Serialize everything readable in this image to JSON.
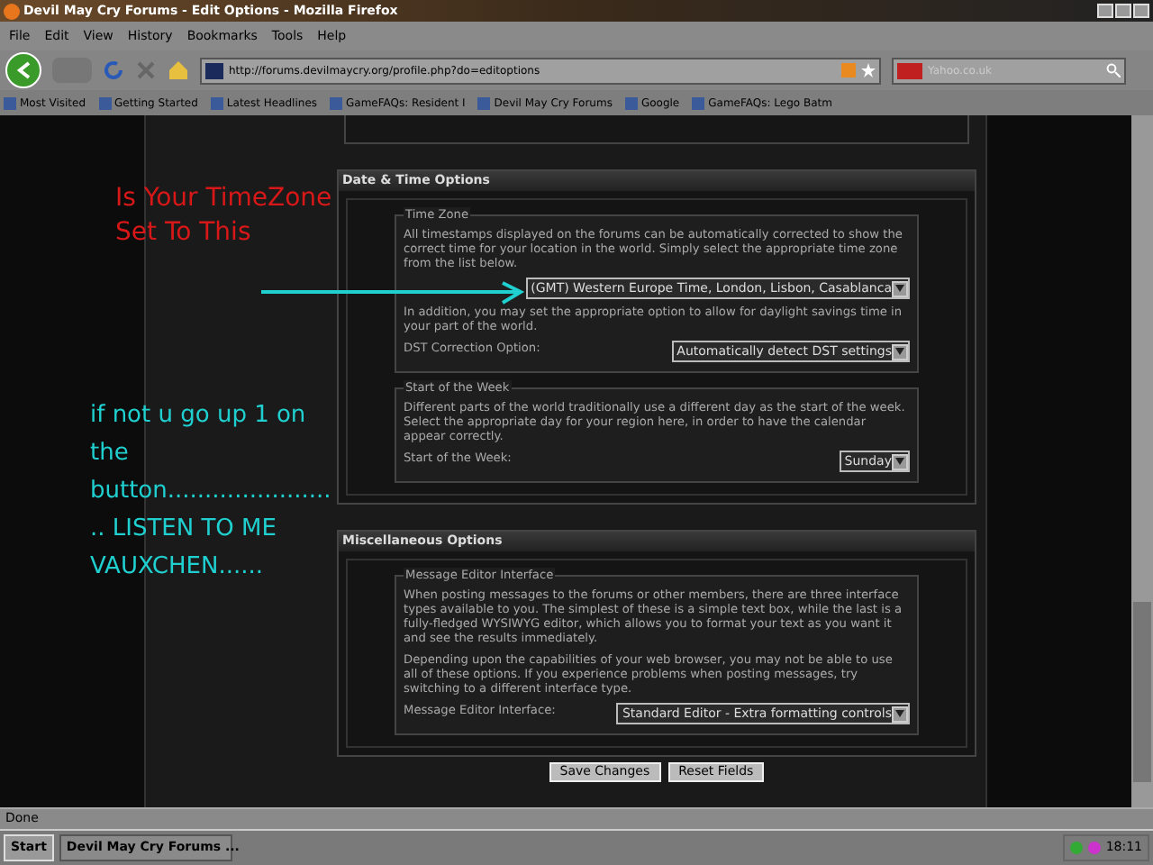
{
  "window": {
    "title": "Devil May Cry Forums - Edit Options - Mozilla Firefox"
  },
  "menu": [
    "File",
    "Edit",
    "View",
    "History",
    "Bookmarks",
    "Tools",
    "Help"
  ],
  "address_bar": {
    "value": "http://forums.devilmaycry.org/profile.php?do=editoptions"
  },
  "search": {
    "placeholder": "Yahoo.co.uk"
  },
  "bookmarks": [
    "Most Visited",
    "Getting Started",
    "Latest Headlines",
    "GameFAQs: Resident I",
    "Devil May Cry Forums",
    "Google",
    "GameFAQs: Lego Batm"
  ],
  "sections": [
    {
      "title": "Date & Time Options",
      "fieldsets": [
        {
          "legend": "Time Zone",
          "rows": [
            {
              "kind": "text",
              "text": "All timestamps displayed on the forums can be automatically corrected to show the correct time for your location in the world. Simply select the appropriate time zone from the list below."
            },
            {
              "kind": "select",
              "value": "(GMT) Western Europe Time, London, Lisbon, Casablanca"
            },
            {
              "kind": "text",
              "text": "In addition, you may set the appropriate option to allow for daylight savings time in your part of the world."
            },
            {
              "kind": "select",
              "label": "DST Correction Option:",
              "value": "Automatically detect DST settings"
            }
          ]
        },
        {
          "legend": "Start of the Week",
          "rows": [
            {
              "kind": "text",
              "text": "Different parts of the world traditionally use a different day as the start of the week. Select the appropriate day for your region here, in order to have the calendar appear correctly."
            },
            {
              "kind": "select",
              "label": "Start of the Week:",
              "value": "Sunday"
            }
          ]
        }
      ]
    },
    {
      "title": "Miscellaneous Options",
      "fieldsets": [
        {
          "legend": "Message Editor Interface",
          "rows": [
            {
              "kind": "text",
              "text": "When posting messages to the forums or other members, there are three interface types available to you. The simplest of these is a simple text box, while the last is a fully-fledged WYSIWYG editor, which allows you to format your text as you want it and see the results immediately."
            },
            {
              "kind": "text",
              "text": "Depending upon the capabilities of your web browser, you may not be able to use all of these options. If you experience problems when posting messages, try switching to a different interface type."
            },
            {
              "kind": "select",
              "label": "Message Editor Interface:",
              "value": "Standard Editor - Extra formatting controls"
            }
          ]
        }
      ]
    }
  ],
  "buttons": [
    "Save Changes",
    "Reset Fields"
  ],
  "annotations": [
    {
      "kind": "red",
      "text": "Is Your TimeZone Set To This"
    },
    {
      "kind": "cyan",
      "text": "if not u go up 1 on the button........................ LISTEN TO ME VAUXCHEN......"
    }
  ],
  "status_bar": {
    "text": "Done"
  },
  "taskbar": {
    "start": "Start",
    "task": "Devil May Cry Forums ...",
    "clock": "18:11"
  }
}
